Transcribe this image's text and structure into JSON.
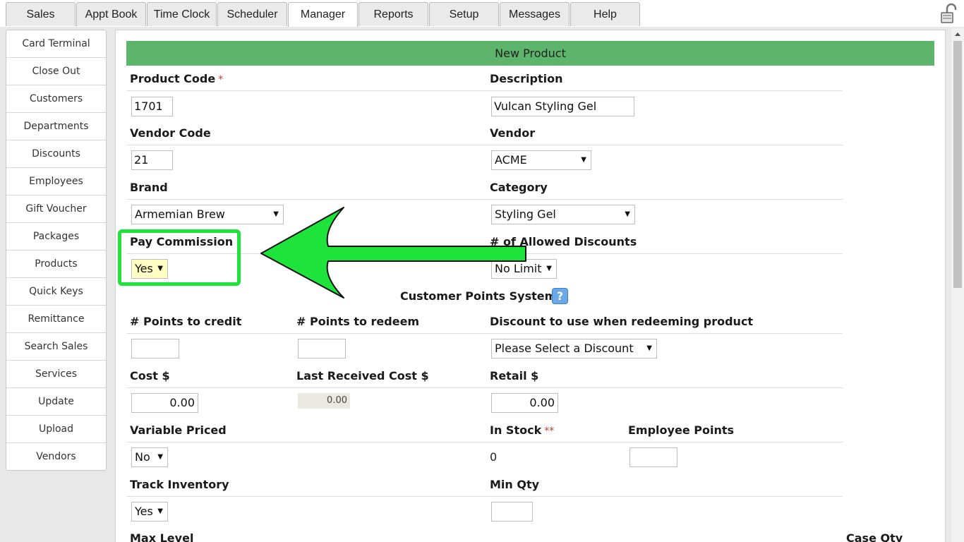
{
  "tabs": [
    {
      "label": "Sales",
      "active": false
    },
    {
      "label": "Appt Book",
      "active": false
    },
    {
      "label": "Time Clock",
      "active": false
    },
    {
      "label": "Scheduler",
      "active": false
    },
    {
      "label": "Manager",
      "active": true
    },
    {
      "label": "Reports",
      "active": false
    },
    {
      "label": "Setup",
      "active": false
    },
    {
      "label": "Messages",
      "active": false
    },
    {
      "label": "Help",
      "active": false
    }
  ],
  "sidebar": {
    "items": [
      {
        "label": "Card Terminal"
      },
      {
        "label": "Close Out"
      },
      {
        "label": "Customers"
      },
      {
        "label": "Departments"
      },
      {
        "label": "Discounts"
      },
      {
        "label": "Employees"
      },
      {
        "label": "Gift Voucher"
      },
      {
        "label": "Packages"
      },
      {
        "label": "Products"
      },
      {
        "label": "Quick Keys"
      },
      {
        "label": "Remittance"
      },
      {
        "label": "Search Sales"
      },
      {
        "label": "Services"
      },
      {
        "label": "Update"
      },
      {
        "label": "Upload"
      },
      {
        "label": "Vendors"
      }
    ]
  },
  "form": {
    "title": "New Product",
    "required_mark": "*",
    "required_mark_double": "**",
    "product_code": {
      "label": "Product Code",
      "value": "1701"
    },
    "description": {
      "label": "Description",
      "value": "Vulcan Styling Gel"
    },
    "vendor_code": {
      "label": "Vendor Code",
      "value": "21"
    },
    "vendor": {
      "label": "Vendor",
      "value": "ACME"
    },
    "brand": {
      "label": "Brand",
      "value": "Armemian Brew"
    },
    "category": {
      "label": "Category",
      "value": "Styling Gel"
    },
    "pay_commission": {
      "label": "Pay Commission",
      "value": "Yes"
    },
    "allowed_discounts": {
      "label": "# of Allowed Discounts",
      "value": "No Limit"
    },
    "points_section": {
      "title": "Customer Points System",
      "help_icon": "?"
    },
    "points_to_credit": {
      "label": "# Points to credit",
      "value": ""
    },
    "points_to_redeem": {
      "label": "# Points to redeem",
      "value": ""
    },
    "redeem_discount": {
      "label": "Discount to use when redeeming product",
      "value": "Please Select a Discount"
    },
    "cost": {
      "label": "Cost $",
      "value": "0.00"
    },
    "last_received_cost": {
      "label": "Last Received Cost $",
      "value": "0.00"
    },
    "retail": {
      "label": "Retail $",
      "value": "0.00"
    },
    "variable_priced": {
      "label": "Variable Priced",
      "value": "No"
    },
    "in_stock": {
      "label": "In Stock",
      "value": "0"
    },
    "employee_points": {
      "label": "Employee Points",
      "value": ""
    },
    "track_inventory": {
      "label": "Track Inventory",
      "value": "Yes"
    },
    "min_qty": {
      "label": "Min Qty",
      "value": ""
    },
    "max_level": {
      "label": "Max Level"
    },
    "case_qty": {
      "label": "Case Qty"
    }
  },
  "annotation": {
    "highlight_color": "#1ee33a",
    "arrow_color": "#1ee33a"
  },
  "icons": {
    "lock": "lock-icon",
    "help": "help-icon",
    "dropdown": "chevron-down-icon"
  }
}
